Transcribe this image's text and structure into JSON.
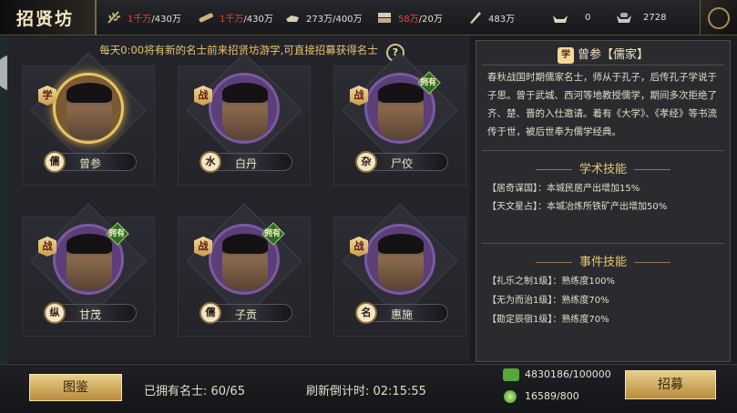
{
  "header": {
    "title": "招贤坊",
    "resources": [
      {
        "icon": "grain-icon",
        "value_red": "1千万",
        "value_rest": "/430万"
      },
      {
        "icon": "wood-icon",
        "value_red": "1千万",
        "value_rest": "/430万"
      },
      {
        "icon": "iron-icon",
        "value_red": "",
        "value_rest": "273万/400万"
      },
      {
        "icon": "stone-icon",
        "value_red": "58万",
        "value_rest": "/20万"
      },
      {
        "icon": "decree-icon",
        "value_red": "",
        "value_rest": "483万"
      },
      {
        "icon": "gold-ingot-icon",
        "value_red": "",
        "value_rest": "0"
      },
      {
        "icon": "silver-ingot-icon",
        "value_red": "",
        "value_rest": "2728"
      }
    ]
  },
  "notice": "每天0:00将有新的名士前来招贤坊游学,可直接招募获得名士",
  "help_label": "?",
  "owned_label": "拥有",
  "scholars": [
    {
      "name": "曾参",
      "badge": "学",
      "school": "儒",
      "owned": false,
      "selected": true
    },
    {
      "name": "白丹",
      "badge": "战",
      "school": "水",
      "owned": false,
      "selected": false
    },
    {
      "name": "尸佼",
      "badge": "战",
      "school": "杂",
      "owned": true,
      "selected": false
    },
    {
      "name": "甘茂",
      "badge": "战",
      "school": "纵",
      "owned": true,
      "selected": false
    },
    {
      "name": "子贡",
      "badge": "战",
      "school": "儒",
      "owned": true,
      "selected": false
    },
    {
      "name": "惠施",
      "badge": "战",
      "school": "名",
      "owned": false,
      "selected": false
    }
  ],
  "detail": {
    "badge": "学",
    "title": "曾参【儒家】",
    "bio": "春秋战国时期儒家名士，师从于孔子，后传孔子学说于子思。曾于武城、西河等地教授儒学，期间多次拒绝了齐、楚、晋的入仕邀请。着有《大学》、《孝经》等书流传于世，被后世奉为儒学经典。",
    "academic_title": "学术技能",
    "academic_skills": [
      "【居奇谋国】：本城民居产出增加15%",
      "【天文星占】：本城冶炼所铁矿产出增加50%"
    ],
    "event_title": "事件技能",
    "event_skills": [
      "【礼乐之制1级】：熟练度100%",
      "【无为而治1级】：熟练度70%",
      "【勘定辰宿1级】：熟练度70%"
    ]
  },
  "footer": {
    "catalog_button": "图鉴",
    "owned_text": "已拥有名士: 60/65",
    "countdown_text": "刷新倒计时: 02:15:55",
    "cost_jade": "4830186/100000",
    "cost_orb": "16589/800",
    "recruit_button": "招募"
  }
}
